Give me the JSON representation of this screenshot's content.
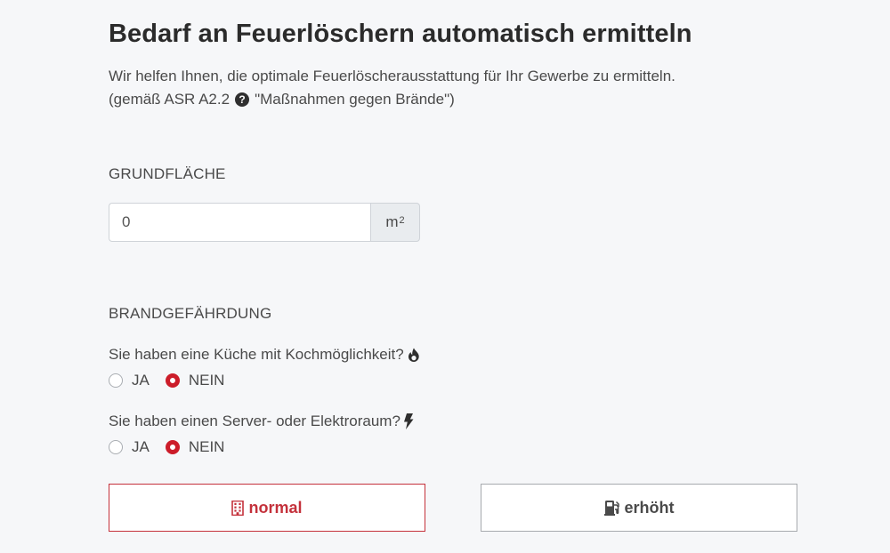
{
  "heading": {
    "title": "Bedarf an Feuerlöschern automatisch ermitteln",
    "intro_line1": "Wir helfen Ihnen, die optimale Feuerlöscherausstattung für Ihr Gewerbe zu ermitteln.",
    "intro_line2_before": "(gemäß ASR A2.2",
    "help_icon_glyph": "?",
    "intro_line2_after": "\"Maßnahmen gegen Brände\")"
  },
  "area": {
    "label": "GRUNDFLÄCHE",
    "value": "0",
    "unit_base": "m",
    "unit_exponent": "2"
  },
  "fire_risk": {
    "label": "BRANDGEFÄHRDUNG",
    "questions": [
      {
        "text": "Sie haben eine Küche mit Kochmöglichkeit?",
        "icon": "fire-icon",
        "options": [
          "JA",
          "NEIN"
        ],
        "selected": "NEIN"
      },
      {
        "text": "Sie haben einen Server- oder Elektroraum?",
        "icon": "bolt-icon",
        "options": [
          "JA",
          "NEIN"
        ],
        "selected": "NEIN"
      }
    ]
  },
  "buttons": {
    "normal_label": "normal",
    "normal_icon": "building-icon",
    "erhoeht_label": "erhöht",
    "erhoeht_icon": "gas-pump-icon",
    "selected": "normal"
  },
  "colors": {
    "accent": "#cc1d2a",
    "background": "#f6f7f9",
    "text": "#4a4a4a",
    "title": "#2b2b2b"
  }
}
